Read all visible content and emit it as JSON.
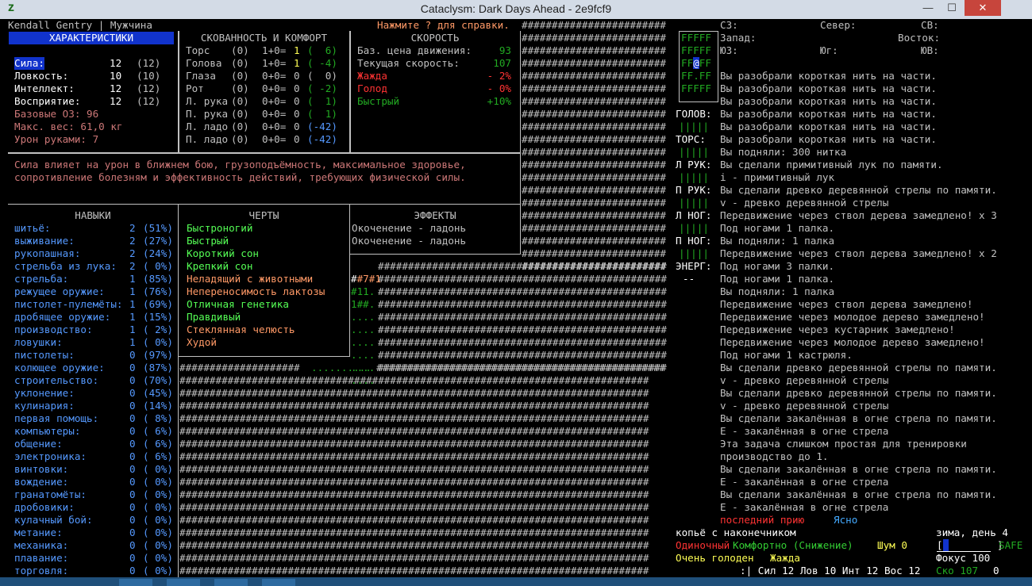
{
  "window": {
    "title": "Cataclysm: Dark Days Ahead - 2e9fcf9",
    "min": "—",
    "max": "☐",
    "close": "✕",
    "app_icon": "z"
  },
  "header": {
    "name": "Kendall Gentry | Мужчина",
    "help": "Нажмите ? для справки."
  },
  "stats": {
    "title": "ХАРАКТЕРИСТИКИ",
    "rows": [
      {
        "label": "Сила:",
        "value": "12",
        "base": "(12)"
      },
      {
        "label": "Ловкость:",
        "value": "10",
        "base": "(10)"
      },
      {
        "label": "Интеллект:",
        "value": "12",
        "base": "(12)"
      },
      {
        "label": "Восприятие:",
        "value": "12",
        "base": "(12)"
      }
    ],
    "extra": [
      "Базовые ОЗ: 96",
      "Макс. вес: 61,0 кг",
      "Урон руками: 7"
    ]
  },
  "encumbrance": {
    "title": "СКОВАННОСТЬ И КОМФОРТ",
    "rows": [
      {
        "part": "Торс",
        "a": "(0)",
        "b": "1+0=",
        "c": "1",
        "d": "(  6)"
      },
      {
        "part": "Голова",
        "a": "(0)",
        "b": "1+0=",
        "c": "1",
        "d": "( -4)"
      },
      {
        "part": "Глаза",
        "a": "(0)",
        "b": "0+0=",
        "c": "0",
        "d": "(  0)"
      },
      {
        "part": "Рот",
        "a": "(0)",
        "b": "0+0=",
        "c": "0",
        "d": "( -2)"
      },
      {
        "part": "Л. рука",
        "a": "(0)",
        "b": "0+0=",
        "c": "0",
        "d": "(  1)"
      },
      {
        "part": "П. рука",
        "a": "(0)",
        "b": "0+0=",
        "c": "0",
        "d": "(  1)"
      },
      {
        "part": "Л. ладо",
        "a": "(0)",
        "b": "0+0=",
        "c": "0",
        "d": "(-42)"
      },
      {
        "part": "П. ладо",
        "a": "(0)",
        "b": "0+0=",
        "c": "0",
        "d": "(-42)"
      }
    ]
  },
  "speed": {
    "title": "СКОРОСТЬ",
    "rows": [
      {
        "label": "Баз. цена движения:",
        "value": "93"
      },
      {
        "label": "Текущая скорость:",
        "value": "107"
      },
      {
        "label": "Жажда",
        "value": "- 2%"
      },
      {
        "label": "Голод",
        "value": "- 0%"
      },
      {
        "label": "Быстрый",
        "value": "+10%"
      }
    ]
  },
  "description": "Сила влияет на урон в ближнем бою, грузоподъёмность, максимальное здоровье,\nсопротивление болезням и эффективность действий, требующих физической силы.",
  "skills": {
    "title": "НАВЫКИ",
    "rows": [
      [
        "шитьё:",
        "2",
        "(51%)"
      ],
      [
        "выживание:",
        "2",
        "(27%)"
      ],
      [
        "рукопашная:",
        "2",
        "(24%)"
      ],
      [
        "стрельба из лука:",
        "2",
        "( 0%)"
      ],
      [
        "стрельба:",
        "1",
        "(85%)"
      ],
      [
        "режущее оружие:",
        "1",
        "(76%)"
      ],
      [
        "пистолет-пулемёты:",
        "1",
        "(69%)"
      ],
      [
        "дробящее оружие:",
        "1",
        "(15%)"
      ],
      [
        "производство:",
        "1",
        "( 2%)"
      ],
      [
        "ловушки:",
        "1",
        "( 0%)"
      ],
      [
        "пистолеты:",
        "0",
        "(97%)"
      ],
      [
        "колющее оружие:",
        "0",
        "(87%)"
      ],
      [
        "строительство:",
        "0",
        "(70%)"
      ],
      [
        "уклонение:",
        "0",
        "(45%)"
      ],
      [
        "кулинария:",
        "0",
        "(14%)"
      ],
      [
        "первая помощь:",
        "0",
        "( 8%)"
      ],
      [
        "компьютеры:",
        "0",
        "( 6%)"
      ],
      [
        "общение:",
        "0",
        "( 6%)"
      ],
      [
        "электроника:",
        "0",
        "( 6%)"
      ],
      [
        "винтовки:",
        "0",
        "( 0%)"
      ],
      [
        "вождение:",
        "0",
        "( 0%)"
      ],
      [
        "гранатомёты:",
        "0",
        "( 0%)"
      ],
      [
        "дробовики:",
        "0",
        "( 0%)"
      ],
      [
        "кулачный бой:",
        "0",
        "( 0%)"
      ],
      [
        "метание:",
        "0",
        "( 0%)"
      ],
      [
        "механика:",
        "0",
        "( 0%)"
      ],
      [
        "плавание:",
        "0",
        "( 0%)"
      ],
      [
        "торговля:",
        "0",
        "( 0%)"
      ]
    ]
  },
  "traits": {
    "title": "ЧЕРТЫ",
    "rows": [
      {
        "t": "Быстроногий",
        "c": "good"
      },
      {
        "t": "Быстрый",
        "c": "good"
      },
      {
        "t": "Короткий сон",
        "c": "good"
      },
      {
        "t": "Крепкий сон",
        "c": "good"
      },
      {
        "t": "Неладящий с животными",
        "c": "bad"
      },
      {
        "t": "Непереносимость лактозы",
        "c": "bad"
      },
      {
        "t": "Отличная генетика",
        "c": "good"
      },
      {
        "t": "Правдивый",
        "c": "good"
      },
      {
        "t": "Стеклянная челюсть",
        "c": "bad"
      },
      {
        "t": "Худой",
        "c": "bad"
      }
    ]
  },
  "effects": {
    "title": "ЭФФЕКТЫ",
    "rows": [
      "Окоченение - ладонь",
      "Окоченение - ладонь"
    ]
  },
  "map_tiles": {
    "a": "#7#1",
    "b": "#11.",
    "c": "1##."
  },
  "minimap": {
    "dirs": {
      "nw": "СЗ:",
      "n": "Север:",
      "ne": "СВ:",
      "w": "Запад:",
      "e": "Восток:",
      "sw": "ЮЗ:",
      "s": "Юг:",
      "se": "ЮВ:"
    },
    "grid": [
      "FFFFF",
      "FFFFF",
      "FF@FF",
      "FF.FF",
      "FFFFF"
    ]
  },
  "body_labels": [
    "ГОЛОВ:",
    "ТОРС:",
    "Л РУК:",
    "П РУК:",
    "Л НОГ:",
    "П НОГ:",
    "ЭНЕРГ:"
  ],
  "hp_bar": "|||||",
  "energy": "--",
  "log": [
    "Вы разобрали короткая нить на части.",
    "Вы разобрали короткая нить на части.",
    "Вы разобрали короткая нить на части.",
    "Вы разобрали короткая нить на части.",
    "Вы разобрали короткая нить на части.",
    "Вы разобрали короткая нить на части.",
    "Вы подняли: 300 нитка",
    "Вы сделали примитивный лук по памяти.",
    "i - примитивный лук",
    "Вы сделали древко деревянной стрелы по памяти.",
    "v - древко деревянной стрелы",
    "Передвижение через ствол дерева замедлено! x 3",
    "Под ногами 1 палка.",
    "Вы подняли: 1 палка",
    "Передвижение через ствол дерева замедлено! x 2",
    "Под ногами 3 палки.",
    "Под ногами 1 палка.",
    "Вы подняли: 1 палка",
    "Передвижение через ствол дерева замедлено!",
    "Передвижение через молодое дерево замедлено!",
    "Передвижение через кустарник замедлено!",
    "Передвижение через молодое дерево замедлено!",
    "Под ногами 1 кастрюля.",
    "Вы сделали древко деревянной стрелы по памяти.",
    "v - древко деревянной стрелы",
    "Вы сделали древко деревянной стрелы по памяти.",
    "v - древко деревянной стрелы",
    "Вы сделали закалённая в огне стрела по памяти.",
    "E - закалённая в огне стрела",
    "Эта задача слишком простая для тренировки",
    "производство до 1.",
    "Вы сделали закалённая в огне стрела по памяти.",
    "E - закалённая в огне стрела",
    "Вы сделали закалённая в огне стрела по памяти.",
    "E - закалённая в огне стрела"
  ],
  "status": {
    "moon": "последний прию",
    "weather": "Ясно",
    "weapon": "копьё с наконечником",
    "season": "зима, день 4",
    "lonely": "Одиночный",
    "comfort": "Комфортно (Снижение)",
    "noise": "Шум 0",
    "safe": "SAFE",
    "hunger": "Очень голоден",
    "thirst": "Жажда",
    "focus": "Фокус 100",
    "bottom": ":| Сил 12 Лов 10 Инт 12 Вос 12",
    "speed": "Ско 107",
    "zero": "0"
  },
  "colors": {
    "accent": "#1133cc",
    "good": "#55ff55",
    "bad": "#ff9966"
  }
}
